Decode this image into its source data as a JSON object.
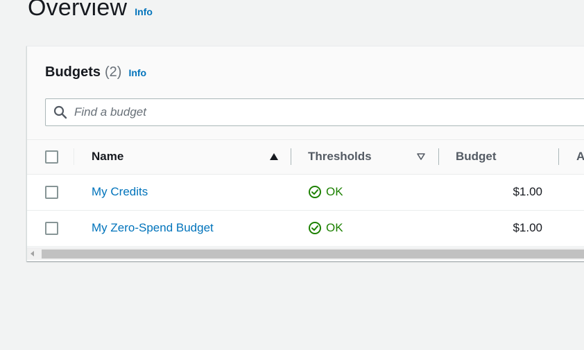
{
  "page": {
    "title": "Overview",
    "info_label": "Info"
  },
  "budgets_panel": {
    "heading": "Budgets",
    "count": "(2)",
    "info_label": "Info",
    "search": {
      "placeholder": "Find a budget",
      "value": ""
    },
    "columns": [
      {
        "label": "Name",
        "sort": "ascending"
      },
      {
        "label": "Thresholds",
        "sort": "sortable"
      },
      {
        "label": "Budget",
        "sort": "none"
      },
      {
        "label": "A",
        "sort": "none"
      }
    ],
    "rows": [
      {
        "name": "My Credits",
        "threshold_status": "OK",
        "budget": "$1.00"
      },
      {
        "name": "My Zero-Spend Budget",
        "threshold_status": "OK",
        "budget": "$1.00"
      }
    ]
  },
  "colors": {
    "link": "#0073bb",
    "status_ok": "#1d8102",
    "background": "#f2f3f3"
  },
  "icons": {
    "search": "search-icon",
    "status_ok": "check-circle-icon",
    "sort_ascending": "caret-up-filled-icon",
    "sort_sortable": "caret-down-outline-icon"
  }
}
